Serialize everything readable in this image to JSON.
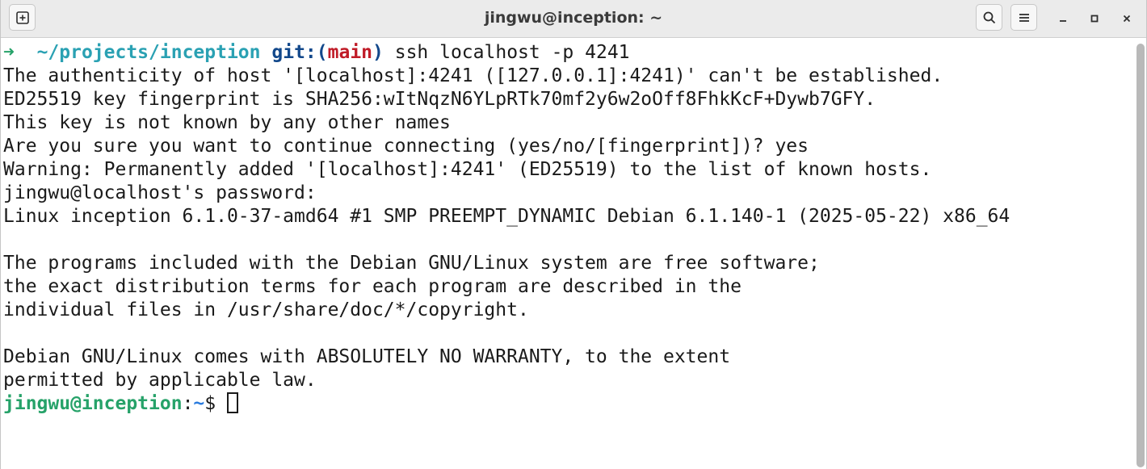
{
  "window": {
    "title": "jingwu@inception: ~",
    "icons": {
      "new_tab": "new-tab-icon",
      "search": "search-icon",
      "menu": "hamburger-menu-icon",
      "minimize": "minimize-icon",
      "maximize": "maximize-icon",
      "close": "close-icon"
    }
  },
  "terminal": {
    "prompt1": {
      "arrow": "➜",
      "path": "~/projects/inception",
      "git": "git:(",
      "branch": "main",
      "git_close": ")",
      "command": " ssh localhost -p 4241"
    },
    "lines": [
      "The authenticity of host '[localhost]:4241 ([127.0.0.1]:4241)' can't be established.",
      "ED25519 key fingerprint is SHA256:wItNqzN6YLpRTk70mf2y6w2oOff8FhkKcF+Dywb7GFY.",
      "This key is not known by any other names",
      "Are you sure you want to continue connecting (yes/no/[fingerprint])? yes",
      "Warning: Permanently added '[localhost]:4241' (ED25519) to the list of known hosts.",
      "jingwu@localhost's password: ",
      "Linux inception 6.1.0-37-amd64 #1 SMP PREEMPT_DYNAMIC Debian 6.1.140-1 (2025-05-22) x86_64",
      "",
      "The programs included with the Debian GNU/Linux system are free software;",
      "the exact distribution terms for each program are described in the",
      "individual files in /usr/share/doc/*/copyright.",
      "",
      "Debian GNU/Linux comes with ABSOLUTELY NO WARRANTY, to the extent",
      "permitted by applicable law."
    ],
    "prompt2": {
      "user_host": "jingwu@inception",
      "sep": ":",
      "path": "~",
      "symbol": "$ "
    }
  }
}
